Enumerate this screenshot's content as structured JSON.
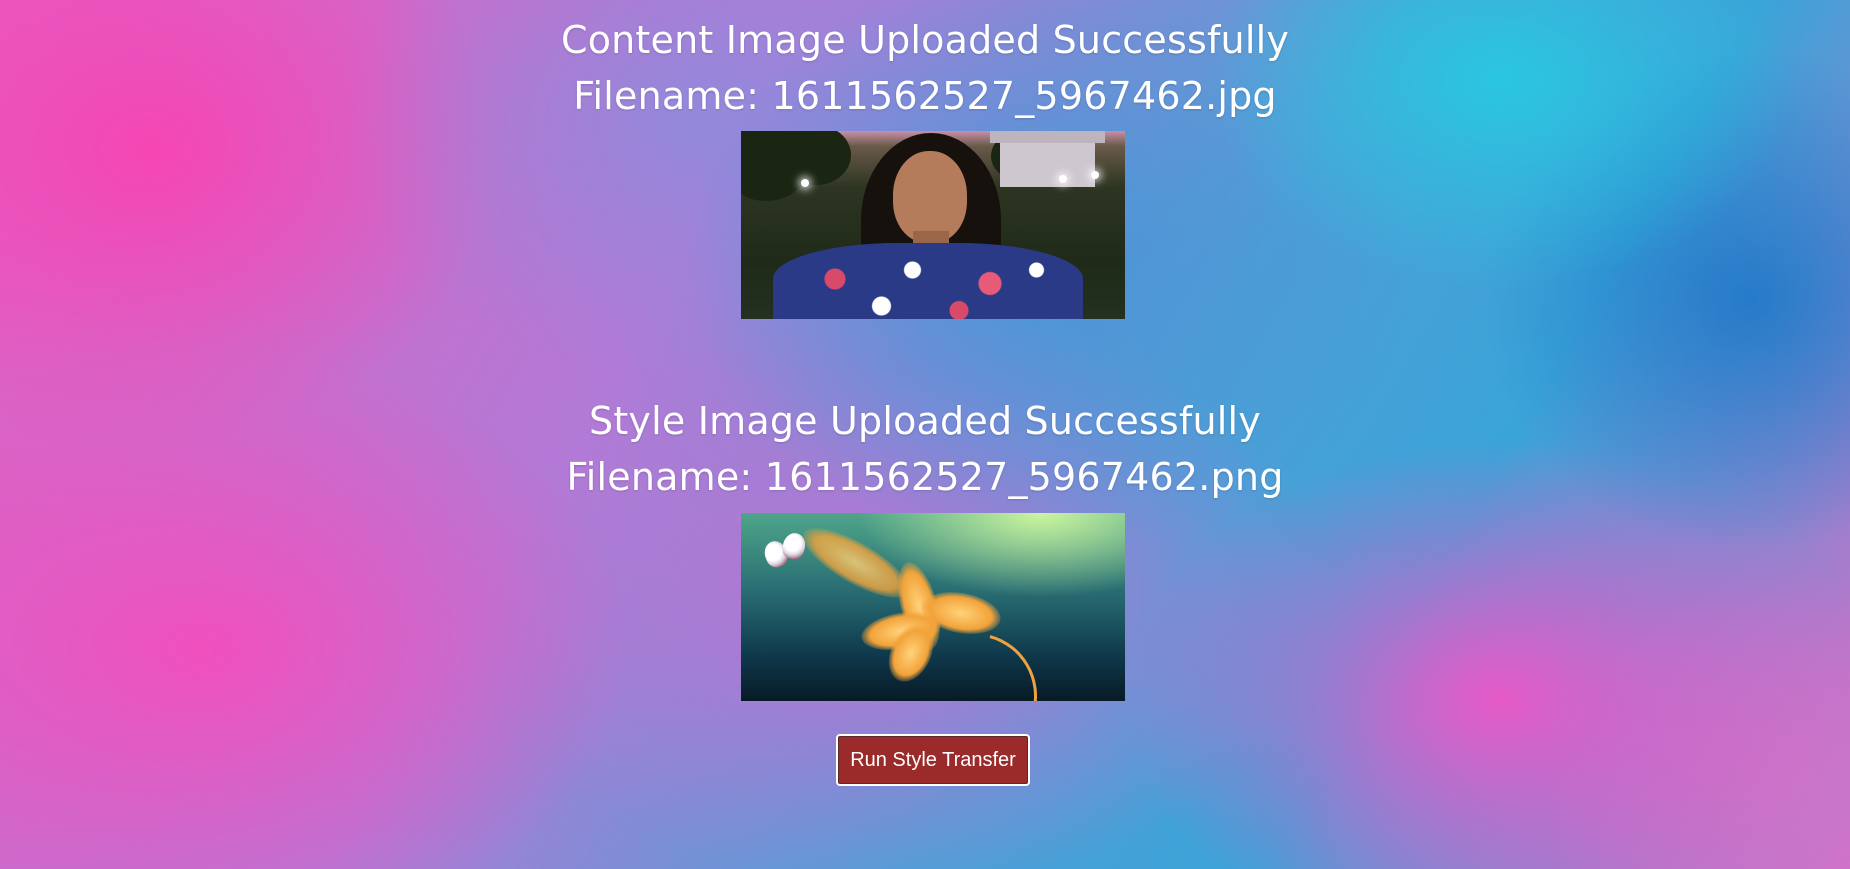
{
  "content_section": {
    "title": "Content Image Uploaded Successfully",
    "filename_text": "Filename: 1611562527_5967462.jpg"
  },
  "style_section": {
    "title": "Style Image Uploaded Successfully",
    "filename_text": "Filename: 1611562527_5967462.png"
  },
  "actions": {
    "run_label": "Run Style Transfer"
  },
  "colors": {
    "button_background": "#9b2a2a",
    "text": "#ffffff"
  }
}
